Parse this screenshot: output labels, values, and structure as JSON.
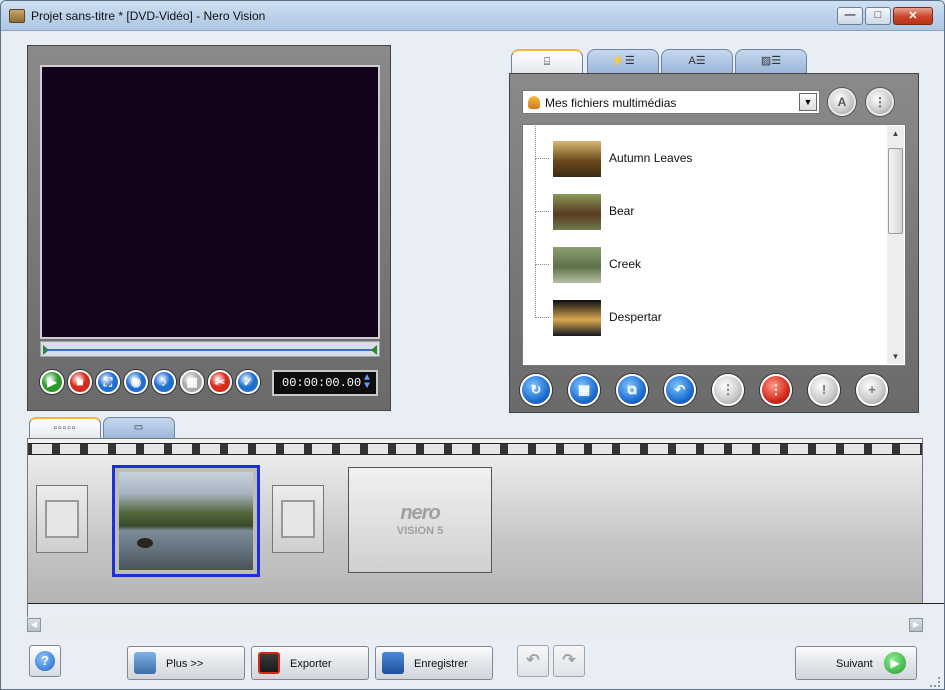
{
  "window": {
    "title": "Projet sans-titre * [DVD-Vidéo] - Nero Vision",
    "min_glyph": "—",
    "max_glyph": "□",
    "close_glyph": "✕"
  },
  "preview": {
    "timecode": "00:00:00.00",
    "controls": [
      {
        "name": "play-button",
        "glyph": "▶",
        "color": "#2a9a2a"
      },
      {
        "name": "stop-button",
        "glyph": "■",
        "color": "#d62a1a"
      },
      {
        "name": "fullscreen-button",
        "glyph": "⛶",
        "color": "#1f6fd0"
      },
      {
        "name": "snapshot-button",
        "glyph": "◉",
        "color": "#1f6fd0"
      },
      {
        "name": "record-audio-button",
        "glyph": "♪",
        "color": "#1f6fd0"
      },
      {
        "name": "film-button",
        "glyph": "▦",
        "color": "#aaaaaa"
      },
      {
        "name": "cut-button",
        "glyph": "✂",
        "color": "#d62a1a"
      },
      {
        "name": "check-button",
        "glyph": "✓",
        "color": "#1f6fd0"
      }
    ]
  },
  "media": {
    "tabs": [
      "⌸",
      "⚡☰",
      "A☰",
      "▨☰"
    ],
    "select_value": "Mes fichiers multimédias",
    "items": [
      {
        "label": "Autumn Leaves",
        "colors": [
          "#d8b870",
          "#6b4a1e",
          "#3a2a14"
        ]
      },
      {
        "label": "Bear",
        "colors": [
          "#8a9a5a",
          "#5a3a22",
          "#6c7a4a"
        ]
      },
      {
        "label": "Creek",
        "colors": [
          "#8aa070",
          "#5d7048",
          "#b4c0a4"
        ]
      },
      {
        "label": "Despertar",
        "colors": [
          "#0c0c10",
          "#d8a850",
          "#141820"
        ]
      }
    ],
    "actions": [
      {
        "name": "media-action-1-button",
        "glyph": "↻",
        "style": "blue"
      },
      {
        "name": "media-action-2-button",
        "glyph": "▦",
        "style": "blue"
      },
      {
        "name": "media-action-3-button",
        "glyph": "⧉",
        "style": "blue"
      },
      {
        "name": "media-action-4-button",
        "glyph": "↶",
        "style": "blue"
      },
      {
        "name": "media-action-5-button",
        "glyph": "⋮",
        "style": "grey"
      },
      {
        "name": "media-action-6-button",
        "glyph": "⋮",
        "style": "red"
      },
      {
        "name": "media-action-7-button",
        "glyph": "!",
        "style": "grey"
      },
      {
        "name": "media-action-8-button",
        "glyph": "+",
        "style": "grey"
      }
    ]
  },
  "storyboard": {
    "tabs": [
      "▫▫▫▫▫",
      "▭"
    ],
    "placeholder_logo": "nero",
    "placeholder_sub": "VISION 5"
  },
  "toolbar": {
    "help": "?",
    "plus": "Plus >>",
    "export": "Exporter",
    "save": "Enregistrer",
    "undo": "↶",
    "redo": "↷",
    "next": "Suivant"
  },
  "colors": {
    "accent_blue": "#1d2fd6",
    "tab_highlight": "#f2b632"
  }
}
